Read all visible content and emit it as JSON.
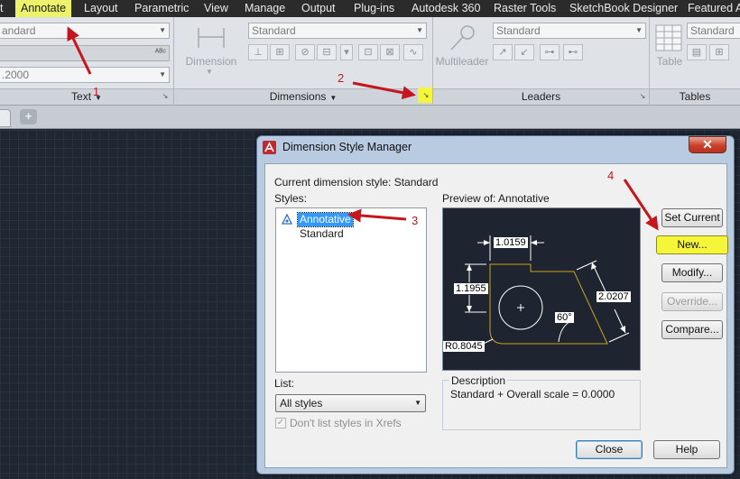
{
  "menubar": {
    "items": [
      "t",
      "Annotate",
      "Layout",
      "Parametric",
      "View",
      "Manage",
      "Output",
      "Plug-ins",
      "Autodesk 360",
      "Raster Tools",
      "SketchBook Designer",
      "Featured A"
    ]
  },
  "ribbon": {
    "text_panel": {
      "combo1": "andard",
      "combo3": ".2000",
      "title": "Text"
    },
    "dimensions_panel": {
      "big_button": "Dimension",
      "combo": "Standard",
      "title": "Dimensions"
    },
    "leaders_panel": {
      "big_button": "Multileader",
      "combo": "Standard",
      "title": "Leaders"
    },
    "tables_panel": {
      "big_button": "Table",
      "combo": "Standard",
      "title": "Tables"
    }
  },
  "dialog": {
    "title": "Dimension Style Manager",
    "current_style_label": "Current dimension style: Standard",
    "styles_label": "Styles:",
    "styles": [
      "Annotative",
      "Standard"
    ],
    "preview_label": "Preview of: Annotative",
    "preview": {
      "dim_top": "1.0159",
      "dim_left": "1.1955",
      "dim_right": "2.0207",
      "angle": "60°",
      "radius": "R0.8045"
    },
    "list_label": "List:",
    "list_value": "All styles",
    "xref_checkbox": "Don't list styles in Xrefs",
    "description_label": "Description",
    "description_text": "Standard + Overall scale = 0.0000",
    "buttons": {
      "set_current": "Set Current",
      "new": "New...",
      "modify": "Modify...",
      "override": "Override...",
      "compare": "Compare...",
      "close": "Close",
      "help": "Help"
    }
  },
  "annotations": [
    "1",
    "2",
    "3",
    "4"
  ],
  "colors": {
    "annotation": "#c4161c",
    "highlight": "#f5f53a",
    "drawing_bg": "#1f2733",
    "preview_line": "#c9a51a"
  }
}
